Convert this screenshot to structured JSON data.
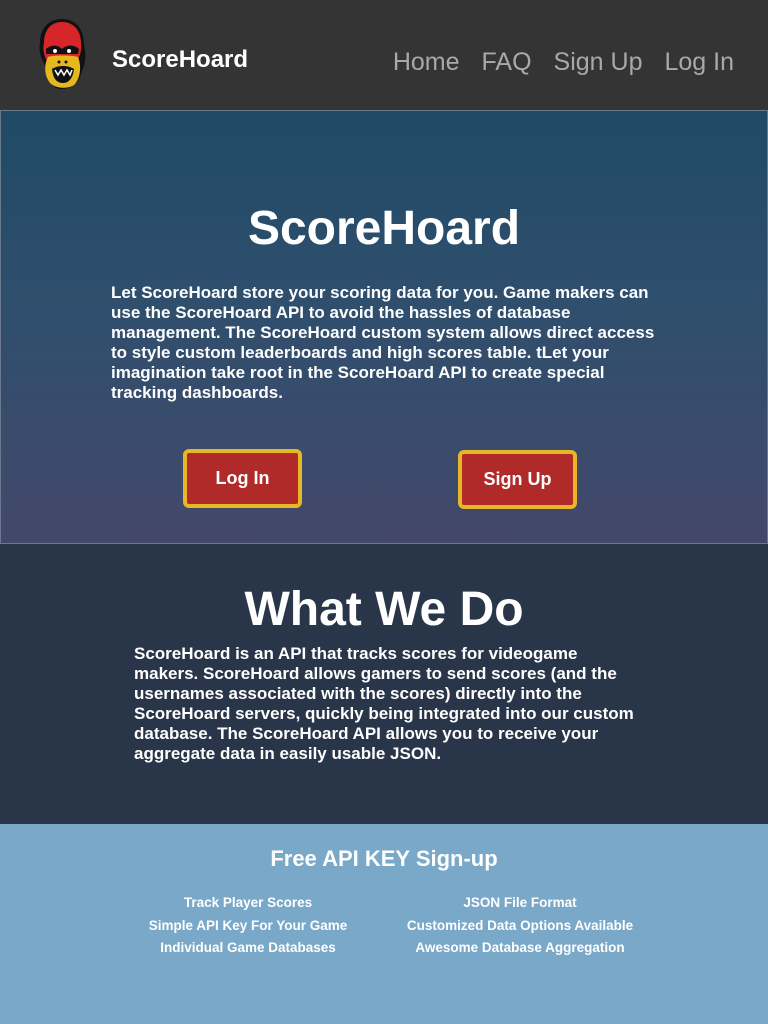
{
  "nav": {
    "brand": "ScoreHoard",
    "links": [
      "Home",
      "FAQ",
      "Sign Up",
      "Log In"
    ]
  },
  "hero": {
    "title": "ScoreHoard",
    "text": "Let ScoreHoard store your scoring data for you. Game makers can use the ScoreHoard API to avoid the hassles of database management. The ScoreHoard custom system allows direct access to style custom leaderboards and high scores table. tLet your imagination take root in the ScoreHoard API to create special tracking dashboards.",
    "login_label": "Log In",
    "signup_label": "Sign Up"
  },
  "what": {
    "title": "What We Do",
    "text": "ScoreHoard is an API that tracks scores for videogame makers. ScoreHoard allows gamers to send scores (and the usernames associated with the scores) directly into the ScoreHoard servers, quickly being integrated into our custom database. The ScoreHoard API allows you to receive your aggregate data in easily usable JSON."
  },
  "features": {
    "title": "Free API KEY Sign-up",
    "left": [
      "Track Player Scores",
      "Simple API Key For Your Game",
      "Individual Game Databases"
    ],
    "right": [
      "JSON File Format",
      "Customized Data Options Available",
      "Awesome Database Aggregation"
    ]
  },
  "colors": {
    "navbar": "#343434",
    "button": "#b12a2a",
    "button_border": "#e8b726",
    "what_bg": "#293548",
    "features_bg": "#7aa8c8"
  }
}
